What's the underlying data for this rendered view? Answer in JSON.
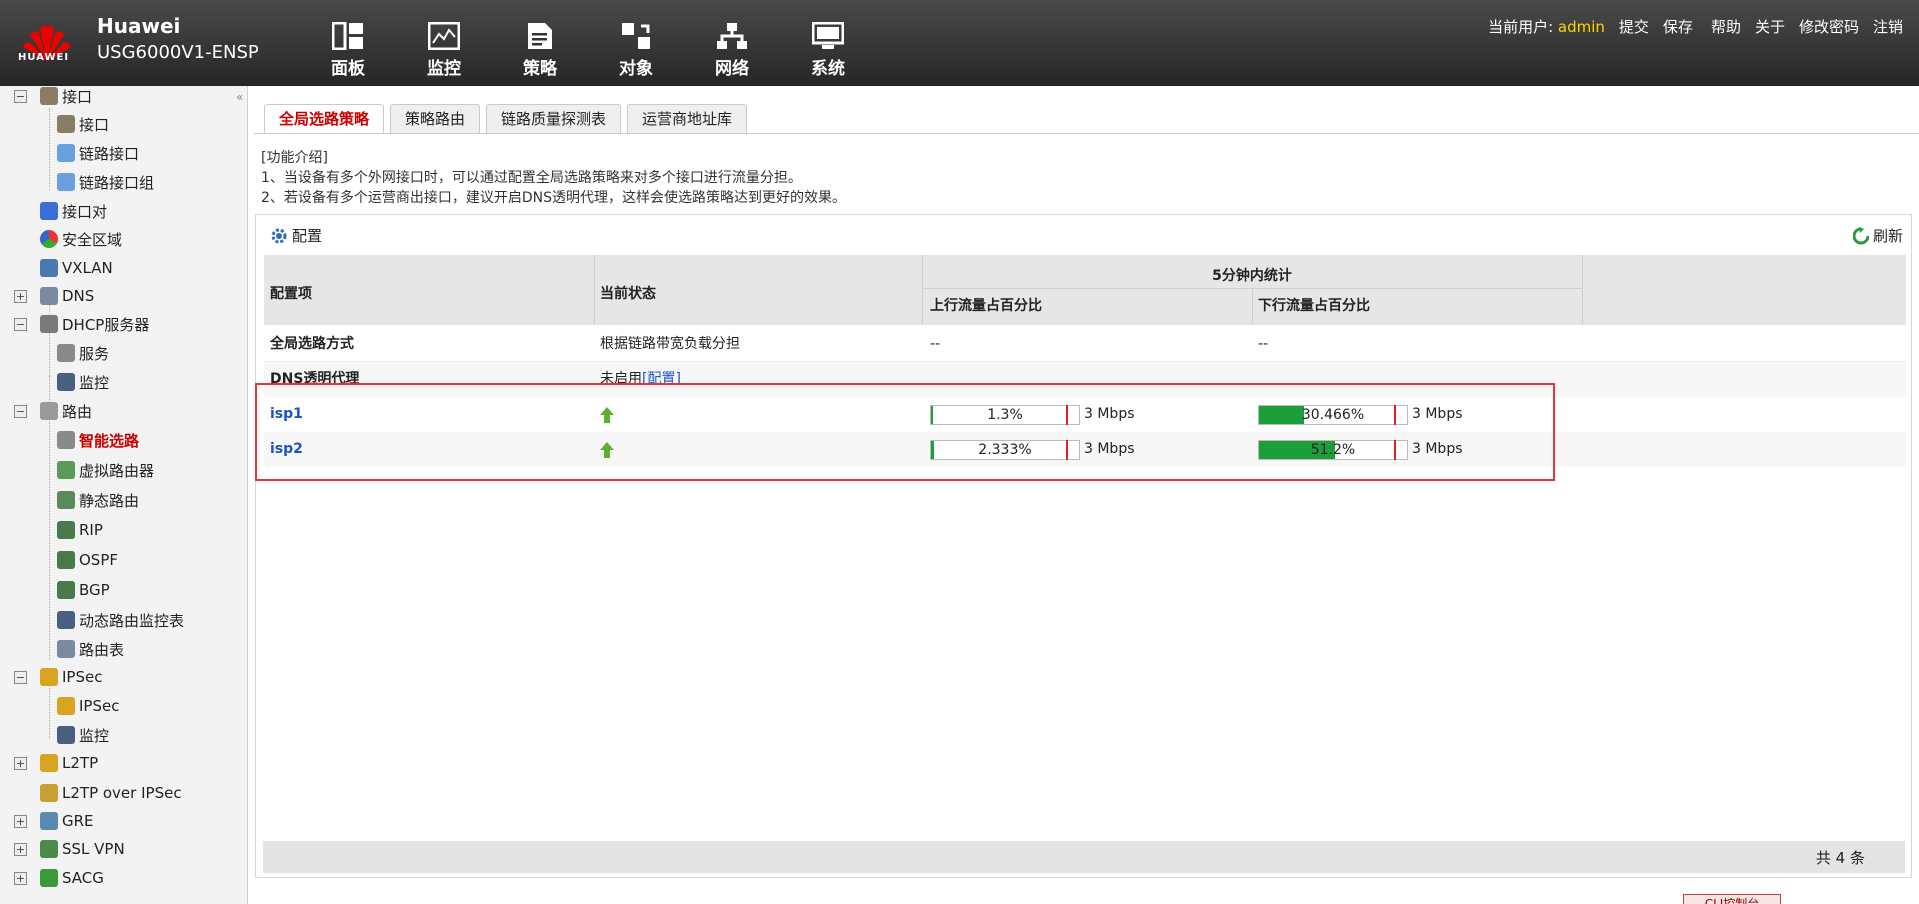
{
  "header": {
    "brand": "Huawei",
    "logo_text": "HUAWEI",
    "model": "USG6000V1-ENSP",
    "nav": [
      {
        "label": "面板",
        "icon": "dashboard-icon"
      },
      {
        "label": "监控",
        "icon": "monitor-icon"
      },
      {
        "label": "策略",
        "icon": "policy-icon"
      },
      {
        "label": "对象",
        "icon": "object-icon"
      },
      {
        "label": "网络",
        "icon": "network-icon"
      },
      {
        "label": "系统",
        "icon": "system-icon"
      }
    ],
    "current_user_label": "当前用户:",
    "username": "admin",
    "links": [
      "提交",
      "保存",
      "帮助",
      "关于",
      "修改密码",
      "注销"
    ]
  },
  "sidebar": {
    "collapse_glyph": "«",
    "items": [
      {
        "label": "接口",
        "toggle": "−"
      },
      {
        "label": "接口"
      },
      {
        "label": "链路接口"
      },
      {
        "label": "链路接口组"
      },
      {
        "label": "接口对"
      },
      {
        "label": "安全区域"
      },
      {
        "label": "VXLAN"
      },
      {
        "label": "DNS",
        "toggle": "+"
      },
      {
        "label": "DHCP服务器",
        "toggle": "−"
      },
      {
        "label": "服务"
      },
      {
        "label": "监控"
      },
      {
        "label": "路由",
        "toggle": "−"
      },
      {
        "label": "智能选路",
        "active": true
      },
      {
        "label": "虚拟路由器"
      },
      {
        "label": "静态路由"
      },
      {
        "label": "RIP"
      },
      {
        "label": "OSPF"
      },
      {
        "label": "BGP"
      },
      {
        "label": "动态路由监控表"
      },
      {
        "label": "路由表"
      },
      {
        "label": "IPSec",
        "toggle": "−"
      },
      {
        "label": "IPSec"
      },
      {
        "label": "监控"
      },
      {
        "label": "L2TP",
        "toggle": "+"
      },
      {
        "label": "L2TP over IPSec"
      },
      {
        "label": "GRE",
        "toggle": "+"
      },
      {
        "label": "SSL VPN",
        "toggle": "+"
      },
      {
        "label": "SACG",
        "toggle": "+"
      }
    ]
  },
  "tabs": [
    "全局选路策略",
    "策略路由",
    "链路质量探测表",
    "运营商地址库"
  ],
  "intro": {
    "title": "[功能介绍]",
    "line1": "1、当设备有多个外网接口时，可以通过配置全局选路策略来对多个接口进行流量分担。",
    "line2": "2、若设备有多个运营商出接口，建议开启DNS透明代理，这样会使选路策略达到更好的效果。"
  },
  "panel": {
    "config_label": "配置",
    "refresh_label": "刷新",
    "headers": {
      "item": "配置项",
      "status": "当前状态",
      "group": "5分钟内统计",
      "up": "上行流量占百分比",
      "down": "下行流量占百分比"
    },
    "rows": {
      "mode": {
        "name": "全局选路方式",
        "status": "根据链路带宽负载分担",
        "up": "--",
        "down": "--"
      },
      "dns": {
        "name": "DNS透明代理",
        "status": "未启用",
        "link": "[配置]"
      },
      "isp1": {
        "name": "isp1",
        "up_pct": "1.3%",
        "up_value": 1.3,
        "up_speed": "3 Mbps",
        "down_pct": "30.466%",
        "down_value": 30.466,
        "down_speed": "3 Mbps"
      },
      "isp2": {
        "name": "isp2",
        "up_pct": "2.333%",
        "up_value": 2.333,
        "up_speed": "3 Mbps",
        "down_pct": "51.2%",
        "down_value": 51.2,
        "down_speed": "3 Mbps"
      }
    },
    "total": "共 4 条"
  },
  "cli_label": "CLI控制台",
  "colors": {
    "accent": "#cc0000",
    "bar_fill": "#1c9f3a",
    "threshold": "#e02020",
    "link": "#1a52c8",
    "highlight": "#e53535"
  }
}
